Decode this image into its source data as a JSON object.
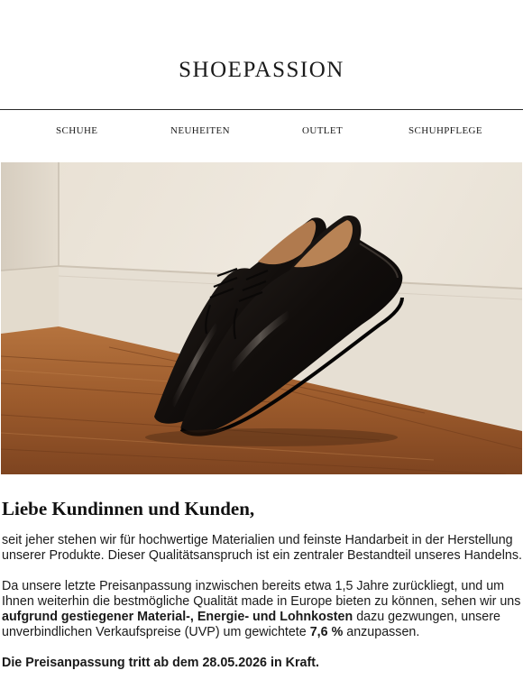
{
  "brand": {
    "logo_text": "SHOEPASSION"
  },
  "nav": {
    "items": [
      {
        "label": "SCHUHE"
      },
      {
        "label": "NEUHEITEN"
      },
      {
        "label": "OUTLET"
      },
      {
        "label": "SCHUHPFLEGE"
      }
    ]
  },
  "hero": {
    "subject": "black-cap-toe-oxford-shoes"
  },
  "letter": {
    "greeting": "Liebe Kundinnen und Kunden,",
    "paragraph1": "seit jeher stehen wir für hochwertige Materialien und feinste Handarbeit in der Herstellung unserer Produkte. Dieser Qualitätsanspruch ist ein zentraler Bestandteil unseres Handelns.",
    "paragraph2": {
      "part1": "Da unsere letzte Preisanpassung inzwischen bereits etwa 1,5 Jahre zurückliegt, und um Ihnen weiterhin die bestmögliche Qualität made in Europe bieten zu können, sehen wir uns ",
      "bold1": "aufgrund gestiegener Material-, Energie- und Lohnkosten",
      "part2": " dazu gezwungen, unsere unverbindlichen Verkaufspreise (UVP) um gewichtete ",
      "bold2": "7,6 %",
      "part3": " anzupassen."
    },
    "final_line": "Die Preisanpassung tritt ab dem 28.05.2026 in Kraft."
  },
  "colors": {
    "text": "#1a1a1a",
    "wall": "#ebe4d9",
    "floor": "#9a5a2f",
    "shoe": "#161210"
  }
}
